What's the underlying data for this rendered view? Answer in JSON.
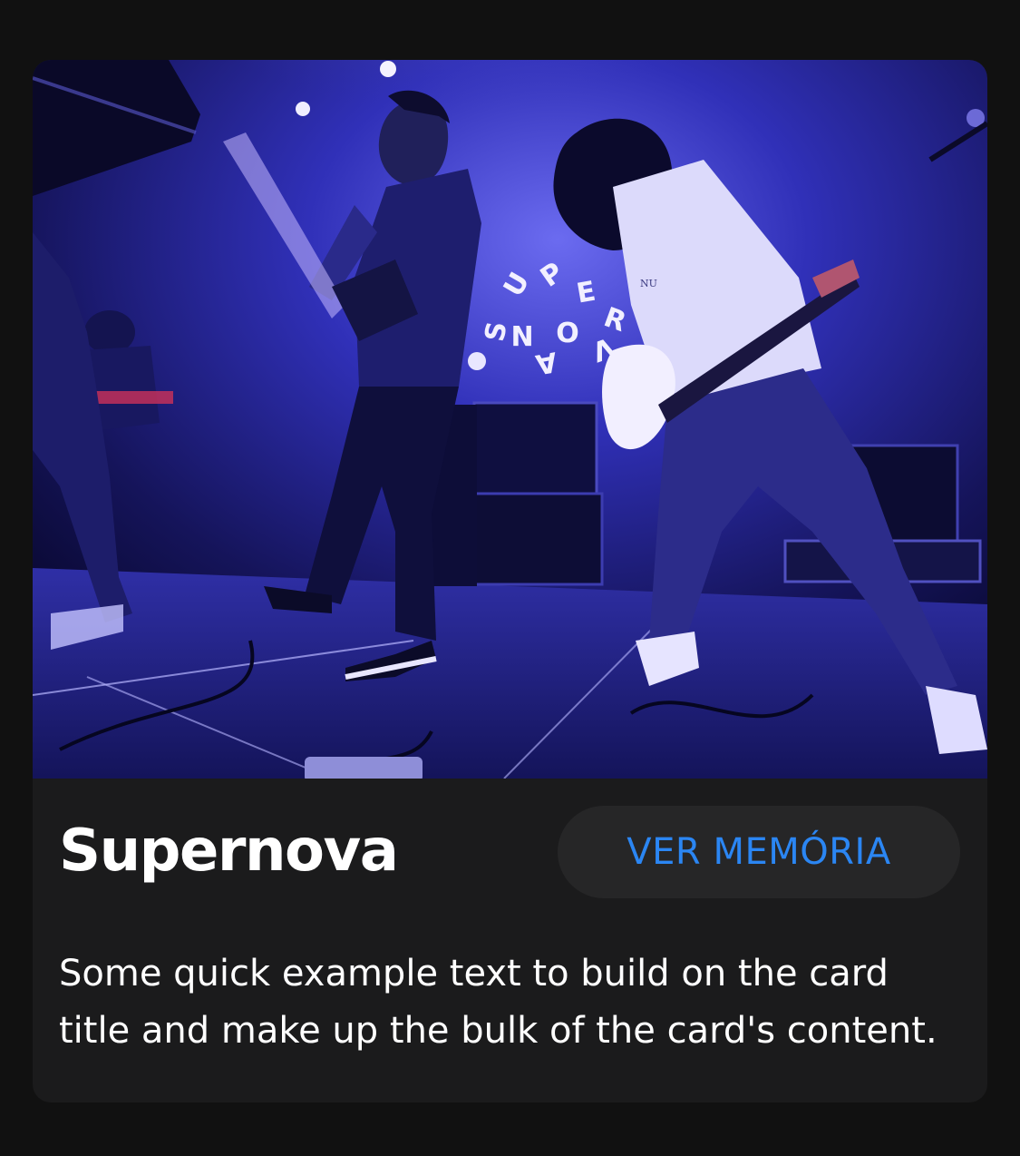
{
  "card": {
    "image": {
      "alt": "",
      "backdrop_letters": [
        "S",
        "U",
        "P",
        "E",
        "R",
        "N",
        "O",
        "V",
        "A"
      ],
      "jersey_text": "NU",
      "colors": {
        "stage_dark": "#0b0a3a",
        "stage_mid": "#2a2aa8",
        "spot_light": "#dcd8ff",
        "floor": "#1c1c6a"
      }
    },
    "title": "Supernova",
    "button_label": "VER MEMÓRIA",
    "text": "Some quick example text to build on the card title and make up the bulk of the card's content.",
    "colors": {
      "page_bg": "#111111",
      "card_bg": "#1b1b1c",
      "button_bg": "#262627",
      "button_text": "#2b86f3",
      "title_text": "#ffffff",
      "body_text": "#ffffff"
    }
  }
}
